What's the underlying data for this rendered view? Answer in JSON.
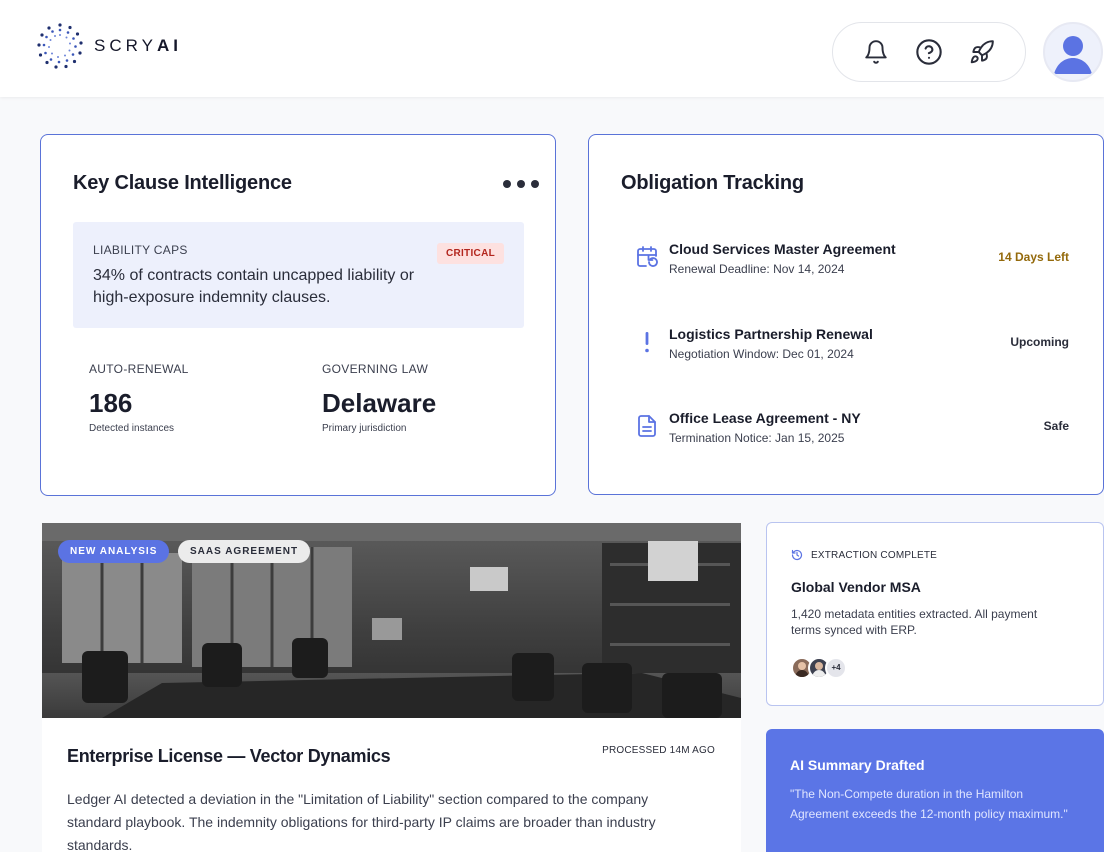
{
  "header": {
    "brand": {
      "name_light": "SCRY",
      "name_bold": "AI",
      "logo_icon": "scry-ai-logo"
    },
    "actions": [
      {
        "icon": "bell-icon"
      },
      {
        "icon": "help-circle-icon"
      },
      {
        "icon": "rocket-icon"
      }
    ],
    "avatar": {
      "icon": "user-avatar-icon"
    }
  },
  "key_clause": {
    "title": "Key Clause Intelligence",
    "more_icon": "more-horizontal-icon",
    "liability": {
      "label": "LIABILITY CAPS",
      "badge": "CRITICAL",
      "text": "34% of contracts contain uncapped liability or high-exposure indemnity clauses."
    },
    "stats": [
      {
        "label": "AUTO-RENEWAL",
        "value": "186",
        "sub": "Detected instances"
      },
      {
        "label": "GOVERNING LAW",
        "value": "Delaware",
        "sub": "Primary jurisdiction"
      }
    ]
  },
  "obligations": {
    "title": "Obligation Tracking",
    "items": [
      {
        "icon": "calendar-refresh-icon",
        "title": "Cloud Services Master Agreement",
        "sub": "Renewal Deadline: Nov 14, 2024",
        "status": "14 Days Left"
      },
      {
        "icon": "exclamation-icon",
        "title": "Logistics Partnership Renewal",
        "sub": "Negotiation Window: Dec 01, 2024",
        "status": "Upcoming"
      },
      {
        "icon": "document-icon",
        "title": "Office Lease Agreement - NY",
        "sub": "Termination Notice: Jan 15, 2025",
        "status": "Safe"
      }
    ]
  },
  "analysis": {
    "tags": [
      "NEW ANALYSIS",
      "SAAS AGREEMENT"
    ],
    "title": "Enterprise License — Vector Dynamics",
    "meta": "PROCESSED 14M AGO",
    "body": "Ledger AI detected a deviation in the \"Limitation of Liability\" section compared to the company standard playbook. The indemnity obligations for third-party IP claims are broader than industry standards."
  },
  "extraction": {
    "label": "EXTRACTION COMPLETE",
    "icon": "history-icon",
    "title": "Global Vendor MSA",
    "body": "1,420 metadata entities extracted. All payment terms synced with ERP.",
    "more_count": "+4"
  },
  "summary": {
    "title": "AI Summary Drafted",
    "body": "\"The Non-Compete duration in the Hamilton Agreement exceeds the 12-month policy maximum.\""
  },
  "colors": {
    "accent": "#5b73e3",
    "card_border": "#5a73d8",
    "critical_text": "#b3261e",
    "critical_bg": "#fde1e0",
    "warn_text": "#946a0c",
    "summary_bg": "#5b75e6"
  }
}
